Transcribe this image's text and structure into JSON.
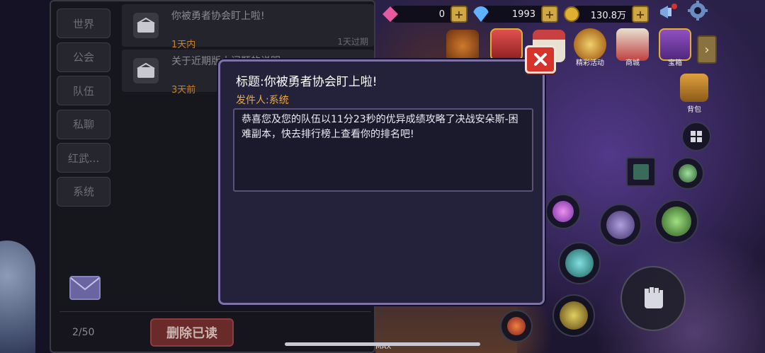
{
  "categories": [
    "世界",
    "公会",
    "队伍",
    "私聊",
    "红武...",
    "系统"
  ],
  "mails": [
    {
      "title": "你被勇者协会盯上啦!",
      "age": "1天内",
      "expire": "1天过期"
    },
    {
      "title": "关于近期版本问题的说明",
      "age": "3天前",
      "expire": ""
    }
  ],
  "footer": {
    "page_count": "2/50",
    "delete_read_label": "删除已读"
  },
  "currencies": [
    {
      "name": "gem",
      "value": "0",
      "color": "#e85aa0"
    },
    {
      "name": "diamond",
      "value": "1993",
      "color": "#5fb2ff"
    },
    {
      "name": "gold",
      "value": "130.8万",
      "color": "#e0b030"
    }
  ],
  "menu": {
    "events_label": "精彩活动",
    "shop_label": "商城",
    "chest_label": "宝箱",
    "bag_label": "背包"
  },
  "dialog": {
    "title": "标题:你被勇者协会盯上啦!",
    "sender": "发件人:系统",
    "body": "恭喜您及您的队伍以11分23秒的优异成绩攻略了决战安朵斯-困难副本，快去排行榜上查看你的排名吧!"
  },
  "hud_bottom": {
    "max_label": "MAX"
  },
  "colors": {
    "accent_close": "#d6332c",
    "dialog_border": "#7e72a6",
    "sender": "#f0a93a",
    "age": "#c9802a"
  }
}
